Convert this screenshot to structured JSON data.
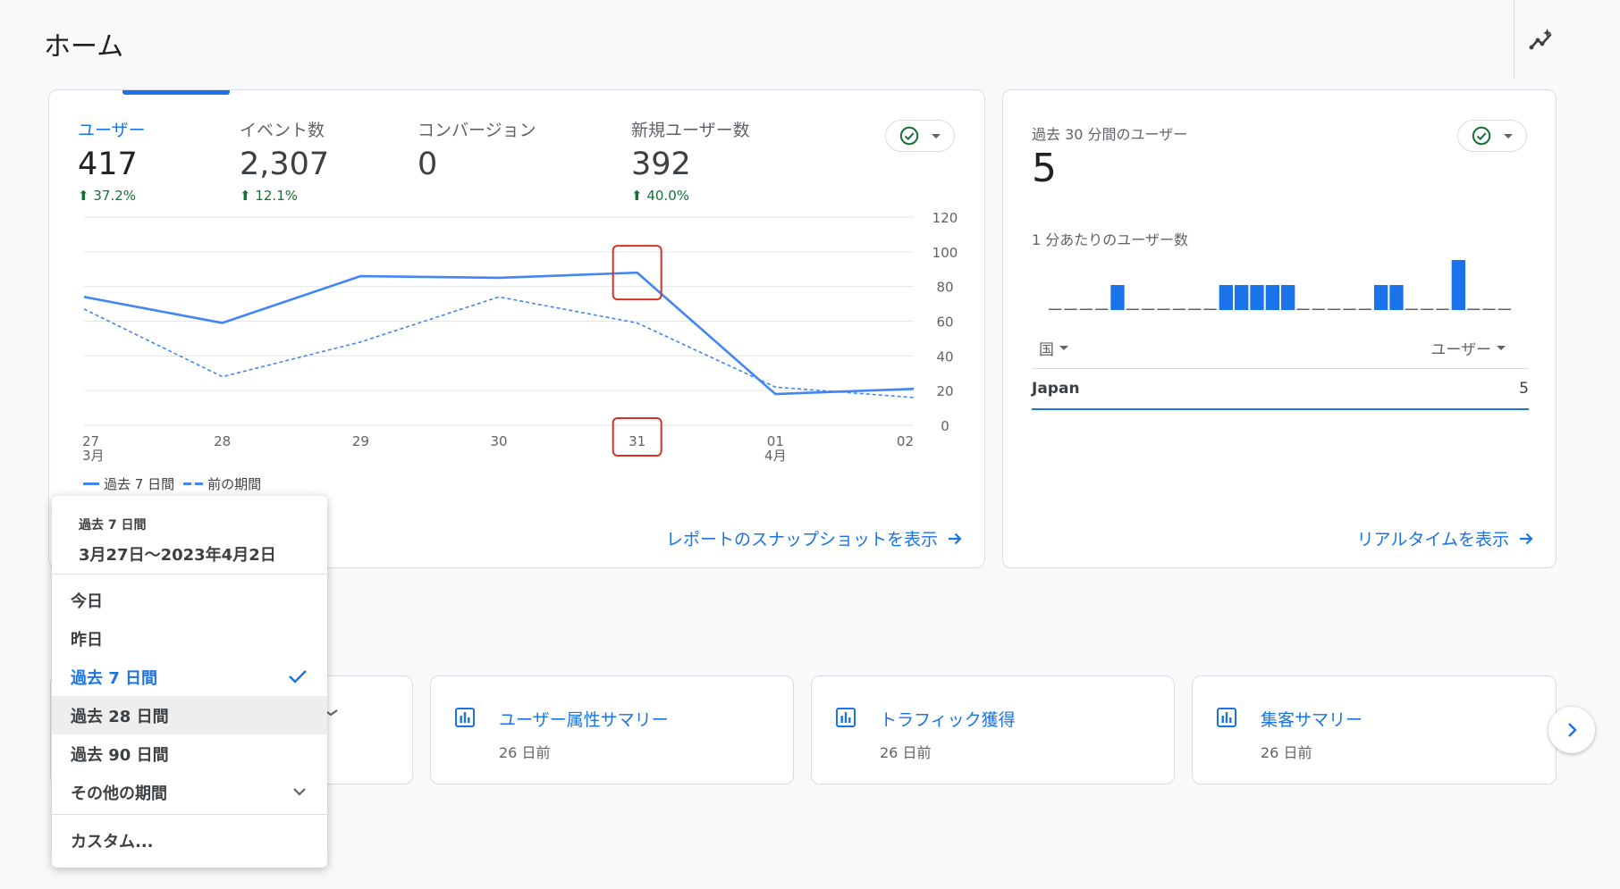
{
  "page": {
    "title": "ホーム"
  },
  "overview": {
    "metrics": [
      {
        "label": "ユーザー",
        "value": "417",
        "delta": "37.2%"
      },
      {
        "label": "イベント数",
        "value": "2,307",
        "delta": "12.1%"
      },
      {
        "label": "コンバージョン",
        "value": "0",
        "delta": ""
      },
      {
        "label": "新規ユーザー数",
        "value": "392",
        "delta": "40.0%"
      }
    ],
    "legend": {
      "current": "過去 7 日間",
      "previous": "前の期間"
    },
    "link_label": "レポートのスナップショットを表示"
  },
  "chart_data": {
    "type": "line",
    "categories": [
      "27",
      "28",
      "29",
      "30",
      "31",
      "01",
      "02"
    ],
    "month_labels": {
      "0": "3月",
      "5": "4月"
    },
    "series": [
      {
        "name": "過去 7 日間",
        "values": [
          74,
          59,
          86,
          85,
          88,
          18,
          21
        ],
        "style": "solid"
      },
      {
        "name": "前の期間",
        "values": [
          67,
          28,
          48,
          74,
          59,
          22,
          16
        ],
        "style": "dashed"
      }
    ],
    "y_ticks": [
      "120",
      "100",
      "80",
      "60",
      "40",
      "20",
      "0"
    ],
    "ylim": [
      0,
      120
    ],
    "grid": true,
    "highlighted_index": 4,
    "color": "#4285f4"
  },
  "realtime": {
    "label": "過去 30 分間のユーザー",
    "value": "5",
    "subtitle": "1 分あたりのユーザー数",
    "bars": [
      0,
      0,
      0,
      0,
      1,
      0,
      0,
      0,
      0,
      0,
      0,
      1,
      1,
      1,
      1,
      1,
      0,
      0,
      0,
      0,
      0,
      1,
      1,
      0,
      0,
      0,
      2,
      0,
      0,
      0
    ],
    "col_country": "国",
    "col_users": "ユーザー",
    "rows": [
      {
        "country": "Japan",
        "users": "5"
      }
    ],
    "link_label": "リアルタイムを表示"
  },
  "suggestions": [
    {
      "title": "ユーザー属性サマリー",
      "subtitle": "26 日前"
    },
    {
      "title": "トラフィック獲得",
      "subtitle": "26 日前"
    },
    {
      "title": "集客サマリー",
      "subtitle": "26 日前"
    }
  ],
  "date_menu": {
    "caption": "過去 7 日間",
    "range": "3月27日～2023年4月2日",
    "items": [
      "今日",
      "昨日",
      "過去 7 日間",
      "過去 28 日間",
      "過去 90 日間",
      "その他の期間"
    ],
    "custom": "カスタム..."
  },
  "colors": {
    "accent": "#1a73e8",
    "positive": "#137333",
    "line": "#4285f4",
    "highlight": "#d93025"
  }
}
